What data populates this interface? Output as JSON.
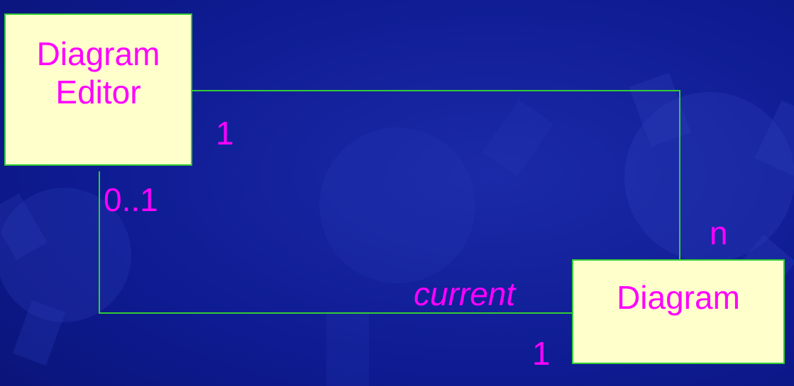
{
  "colors": {
    "background": "#0d1a8f",
    "box_fill": "#ffffcc",
    "line": "#33cc33",
    "text": "#ff00ff"
  },
  "classes": {
    "diagram_editor": [
      "Diagram",
      "Editor"
    ],
    "diagram": "Diagram"
  },
  "associations": {
    "editor_to_diagrams": {
      "editor_end": "1",
      "diagram_end": "n"
    },
    "current_diagram": {
      "editor_end": "0..1",
      "role": "current",
      "diagram_end": "1"
    }
  }
}
